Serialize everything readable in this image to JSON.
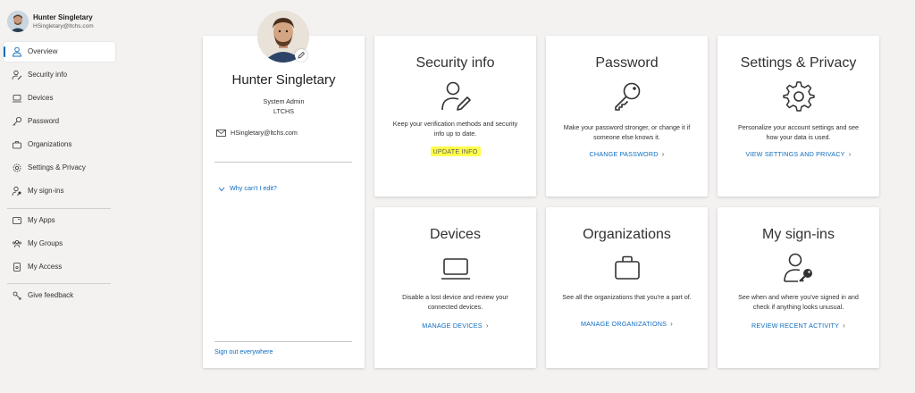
{
  "user": {
    "name": "Hunter Singletary",
    "email": "HSingletary@ltchs.com"
  },
  "nav": {
    "overview": "Overview",
    "security_info": "Security info",
    "devices": "Devices",
    "password": "Password",
    "organizations": "Organizations",
    "settings_privacy": "Settings & Privacy",
    "my_signins": "My sign-ins",
    "my_apps": "My Apps",
    "my_groups": "My Groups",
    "my_access": "My Access",
    "give_feedback": "Give feedback"
  },
  "profile": {
    "name": "Hunter Singletary",
    "role": "System Admin",
    "org": "LTCHS",
    "email": "HSingletary@ltchs.com",
    "why_cant_edit": "Why can't I edit?",
    "sign_out_everywhere": "Sign out everywhere"
  },
  "tiles": {
    "security": {
      "title": "Security info",
      "desc_line1": "Keep your verification methods and security",
      "desc_line2": "info up to date.",
      "link": "UPDATE INFO"
    },
    "password": {
      "title": "Password",
      "desc_line1": "Make your password stronger, or change it if",
      "desc_line2": "someone else knows it.",
      "link": "CHANGE PASSWORD"
    },
    "settings": {
      "title": "Settings & Privacy",
      "desc_line1": "Personalize your account settings and see",
      "desc_line2": "how your data is used.",
      "link": "VIEW SETTINGS AND PRIVACY"
    },
    "devices": {
      "title": "Devices",
      "desc_line1": "Disable a lost device and review your",
      "desc_line2": "connected devices.",
      "link": "MANAGE DEVICES"
    },
    "organizations": {
      "title": "Organizations",
      "desc_line1": "See all the organizations that you're a part of.",
      "link": "MANAGE ORGANIZATIONS"
    },
    "signins": {
      "title": "My sign-ins",
      "desc_line1": "See when and where you've signed in and",
      "desc_line2": "check if anything looks unusual.",
      "link": "REVIEW RECENT ACTIVITY"
    }
  },
  "chevron": "›",
  "colors": {
    "accent": "#0f6cbd",
    "highlight": "#ffff4a",
    "background": "#f3f2f1"
  }
}
